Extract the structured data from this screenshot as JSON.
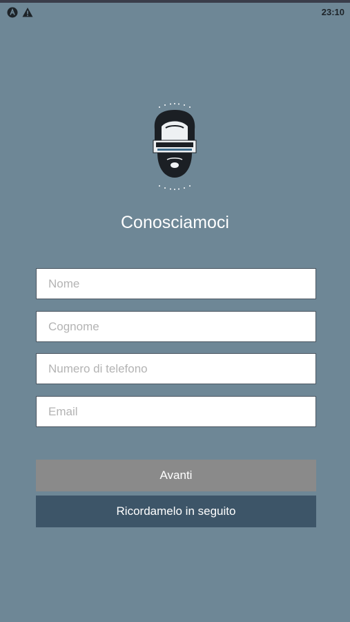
{
  "status_bar": {
    "time": "23:10",
    "icons": [
      "app-notification-icon",
      "warning-icon"
    ]
  },
  "logo": {
    "name": "La Barberia logo"
  },
  "page": {
    "title": "Conosciamoci"
  },
  "form": {
    "fields": [
      {
        "name": "first-name",
        "placeholder": "Nome",
        "value": ""
      },
      {
        "name": "last-name",
        "placeholder": "Cognome",
        "value": ""
      },
      {
        "name": "phone",
        "placeholder": "Numero di telefono",
        "value": ""
      },
      {
        "name": "email",
        "placeholder": "Email",
        "value": ""
      }
    ]
  },
  "actions": {
    "next_label": "Avanti",
    "later_label": "Ricordamelo in seguito"
  },
  "colors": {
    "background": "#6e8796",
    "next_button": "#8a8a8a",
    "later_button": "#3d5568"
  }
}
